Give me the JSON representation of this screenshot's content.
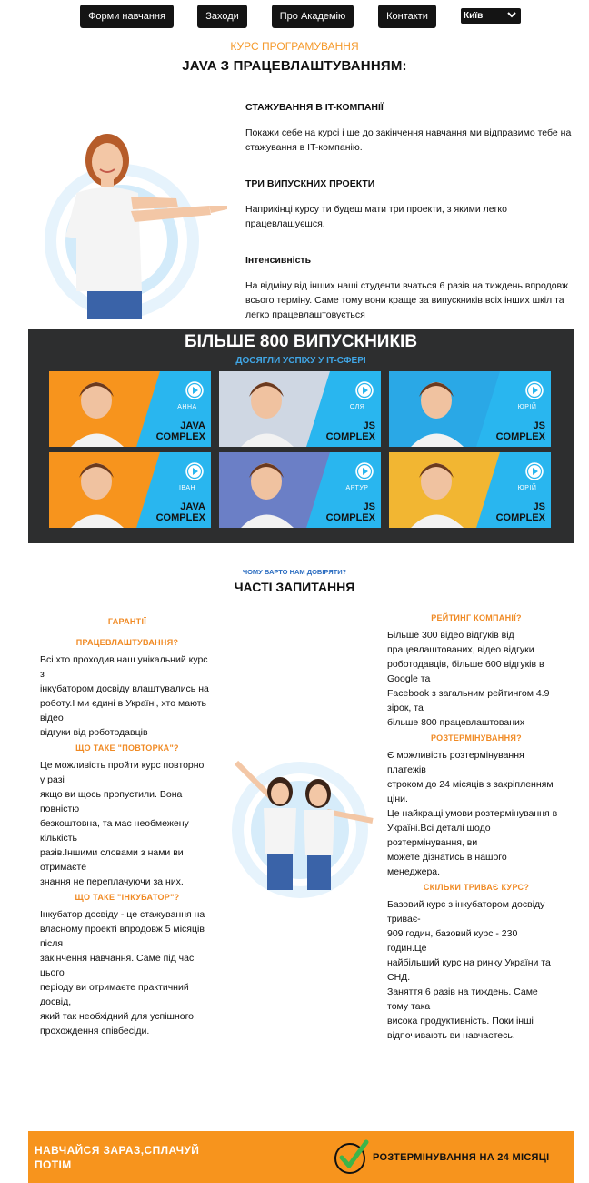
{
  "nav": {
    "items": [
      {
        "label": "Форми навчання"
      },
      {
        "label": "Заходи"
      },
      {
        "label": "Про Академію"
      },
      {
        "label": "Контакти"
      }
    ],
    "city": "Київ"
  },
  "hero": {
    "kicker": "КУРС ПРОГРАМУВАННЯ",
    "title": "JAVA З ПРАЦЕВЛАШТУВАННЯМ:",
    "features": [
      {
        "heading": "СТАЖУВАННЯ В IT-КОМПАНІЇ",
        "text": "Покажи себе на курсі і ще до закінчення навчання ми відправимо тебе на стажування в IT-компанію."
      },
      {
        "heading": "ТРИ ВИПУСКНИХ ПРОЕКТИ",
        "text": "Наприкінці курсу ти будеш мати три проекти, з якими легко працевлашуєшся."
      },
      {
        "heading": "Інтенсивність",
        "text": "На відміну від інших наші студенти вчаться 6 разів на тиждень впродовж всього терміну. Саме тому вони краще за випускників всіх інших шкіл та легко працевлаштовується"
      }
    ]
  },
  "graduates": {
    "title": "БІЛЬШЕ 800 ВИПУСКНИКІВ",
    "subtitle": "ДОСЯГЛИ УСПІХУ У IT-СФЕРІ",
    "cards": [
      {
        "name": "АННА",
        "course1": "JAVA",
        "course2": "COMPLEX",
        "bg": "#f7941d"
      },
      {
        "name": "ОЛЯ",
        "course1": "JS",
        "course2": "COMPLEX",
        "bg": "#cfd7e3"
      },
      {
        "name": "ЮРІЙ",
        "course1": "JS",
        "course2": "COMPLEX",
        "bg": "#2aa8e6"
      },
      {
        "name": "ІВАН",
        "course1": "JAVA",
        "course2": "COMPLEX",
        "bg": "#f7941d"
      },
      {
        "name": "АРТУР",
        "course1": "JS",
        "course2": "COMPLEX",
        "bg": "#6b7fc6"
      },
      {
        "name": "ЮРІЙ",
        "course1": "JS",
        "course2": "COMPLEX",
        "bg": "#f2b632"
      }
    ]
  },
  "faq": {
    "kicker": "ЧОМУ ВАРТО НАМ ДОВІРЯТИ?",
    "title": "ЧАСТІ ЗАПИТАННЯ",
    "left": [
      {
        "q": "ГАРАНТІЇ",
        "a": ""
      },
      {
        "q": "ПРАЦЕВЛАШТУВАННЯ?",
        "a": "Всі хто проходив наш унікальний курс\nз\nінкубатором досвіду влаштувались на\nроботу.І ми єдині в Україні, хто мають\nвідео\nвідгуки від роботодавців"
      },
      {
        "q": "ЩО ТАКЕ \"ПОВТОРКА\"?",
        "a": "Це можливість пройти курс повторно\nу разі\nякщо ви щось пропустили. Вона\nповністю\nбезкоштовна, та має необмежену\nкількість\nразів.Іншими словами з нами ви\nотримаєте\nзнання не переплачуючи за них."
      },
      {
        "q": "ЩО ТАКЕ \"ІНКУБАТОР\"?",
        "a": "Інкубатор досвіду - це стажування на\nвласному проекті впродовж 5 місяців\nпісля\nзакінчення навчання. Саме під час\nцього\nперіоду ви отримаєте практичний\nдосвід,\nякий так необхідний для успішного\nпрохождення співбесіди."
      }
    ],
    "right": [
      {
        "q": "РЕЙТИНГ КОМПАНІЇ?",
        "a": "Більше 300 відео відгуків від\nпрацевлаштованих, відео відгуки\nроботодавців, більше 600 відгуків в\nGoogle та\nFacebook з загальним рейтингом 4.9\nзірок, та\nбільше 800 працевлаштованих"
      },
      {
        "q": "РОЗТЕРМІНУВАННЯ?",
        "a": "Є можливість розтермінування\nплатежів\nстроком до 24 місяців з закріпленням\nціни.\nЦе найкращі умови розтермінування в\nУкраїні.Всі деталі щодо\nрозтермінування, ви\nможете дізнатись в нашого\nменеджера."
      },
      {
        "q": "СКІЛЬКИ ТРИВАЄ КУРС?",
        "a": "Базовий курс з інкубатором досвіду\nтриває-\n909 годин, базовий курс - 230\nгодин.Це\nнайбільший курс на ринку України та\nСНД.\nЗаняття 6 разів на тиждень. Саме\nтому така\nвисока продуктивність. Поки інші\nвідпочивають ви навчаєтесь."
      }
    ]
  },
  "banner": {
    "left": "НАВЧАЙСЯ ЗАРАЗ,СПЛАЧУЙ ПОТІМ",
    "right": "РОЗТЕРМІНУВАННЯ НА 24 МІСЯЦІ"
  },
  "colors": {
    "accent": "#f7941d",
    "blue": "#29b6ef",
    "dark": "#2d2e2f"
  }
}
